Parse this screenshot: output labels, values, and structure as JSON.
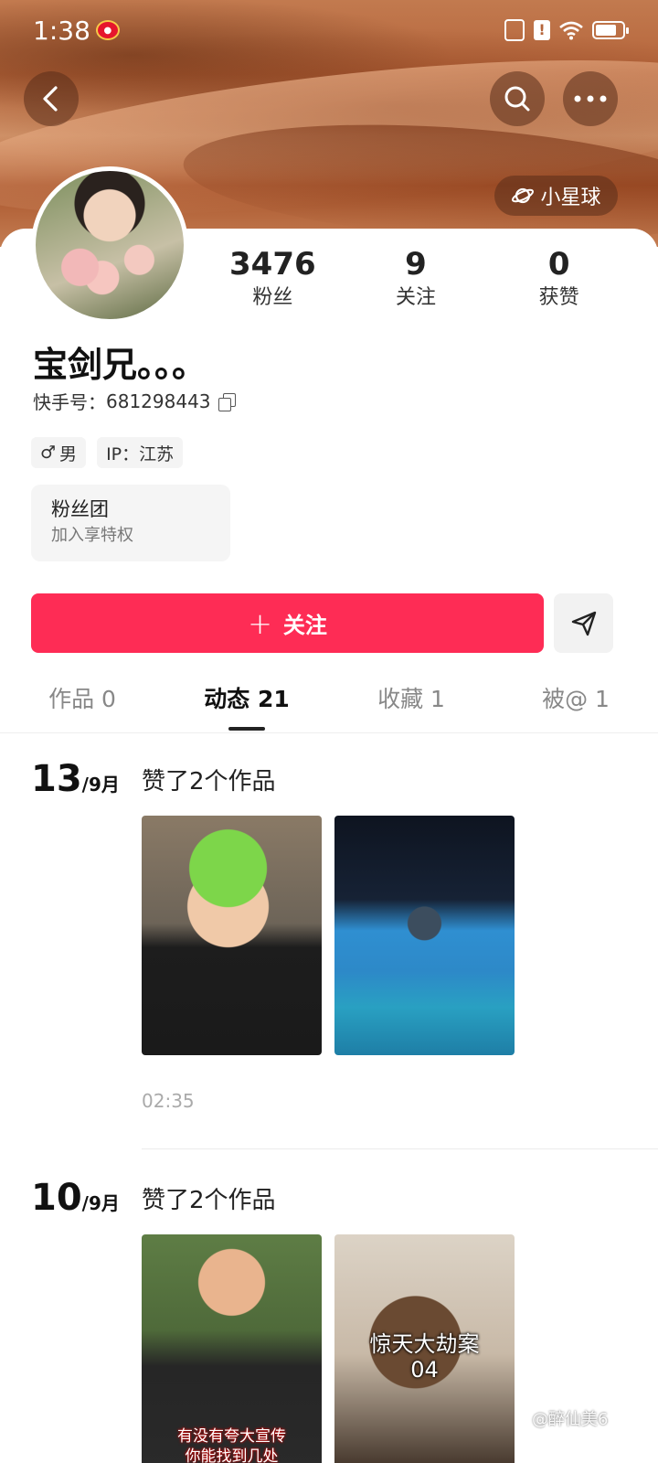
{
  "status_bar": {
    "time": "1:38"
  },
  "header": {
    "planet_label": "小星球"
  },
  "profile": {
    "nickname": "宝剑兄。。。",
    "user_id_label": "快手号：",
    "user_id": "681298443",
    "stats": [
      {
        "value": "3476",
        "label": "粉丝"
      },
      {
        "value": "9",
        "label": "关注"
      },
      {
        "value": "0",
        "label": "获赞"
      }
    ],
    "tags": [
      {
        "icon": "male-icon",
        "glyph": "♂",
        "text": "男"
      },
      {
        "icon": "",
        "glyph": "",
        "text": "IP：江苏"
      }
    ],
    "fan_club": {
      "title": "粉丝团",
      "subtitle": "加入享特权"
    }
  },
  "actions": {
    "follow_label": "关注"
  },
  "tabs": [
    {
      "label": "作品 0",
      "active": false
    },
    {
      "label": "动态 21",
      "active": true
    },
    {
      "label": "收藏 1",
      "active": false
    },
    {
      "label": "被@ 1",
      "active": false
    }
  ],
  "feed": [
    {
      "day": "13",
      "month": "/9月",
      "title": "赞了2个作品",
      "time": "02:35",
      "thumbs": [
        {
          "caption": ""
        },
        {
          "caption": ""
        }
      ]
    },
    {
      "day": "10",
      "month": "/9月",
      "title": "赞了2个作品",
      "thumbs": [
        {
          "caption": "有没有夸大宣传\n你能找到几处"
        },
        {
          "caption": "惊天大劫案\n04"
        }
      ]
    }
  ],
  "watermark": "@醉仙美6",
  "colors": {
    "accent": "#fe2c55"
  }
}
